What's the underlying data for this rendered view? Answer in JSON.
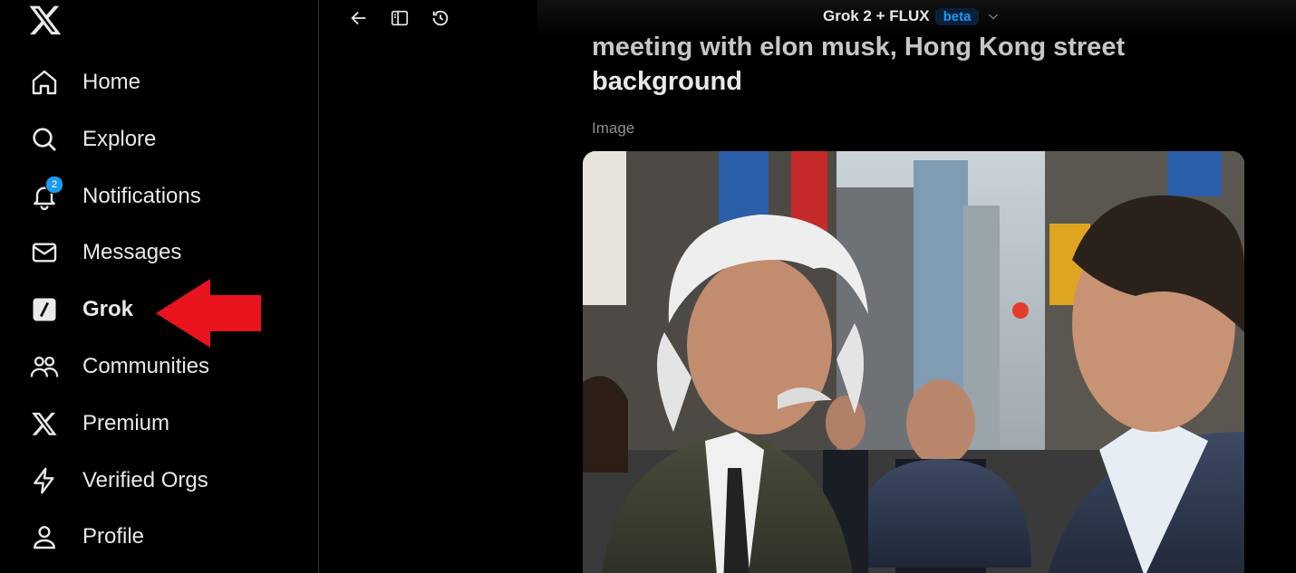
{
  "sidebar": {
    "logo_icon": "x-logo-icon",
    "items": [
      {
        "label": "Home",
        "icon": "home-icon"
      },
      {
        "label": "Explore",
        "icon": "search-icon"
      },
      {
        "label": "Notifications",
        "icon": "bell-icon",
        "badge": "2"
      },
      {
        "label": "Messages",
        "icon": "envelope-icon"
      },
      {
        "label": "Grok",
        "icon": "grok-icon",
        "active": true
      },
      {
        "label": "Communities",
        "icon": "people-icon"
      },
      {
        "label": "Premium",
        "icon": "x-icon"
      },
      {
        "label": "Verified Orgs",
        "icon": "lightning-icon"
      },
      {
        "label": "Profile",
        "icon": "person-icon"
      }
    ],
    "annotation_color": "#e8131d"
  },
  "topbar": {
    "model_name": "Grok 2 + FLUX",
    "beta_label": "beta",
    "accent": "#1d9bf0"
  },
  "content": {
    "prompt_tail_cut": "meeting with elon musk, Hong Kong street",
    "prompt_tail": "background",
    "image_label": "Image"
  }
}
